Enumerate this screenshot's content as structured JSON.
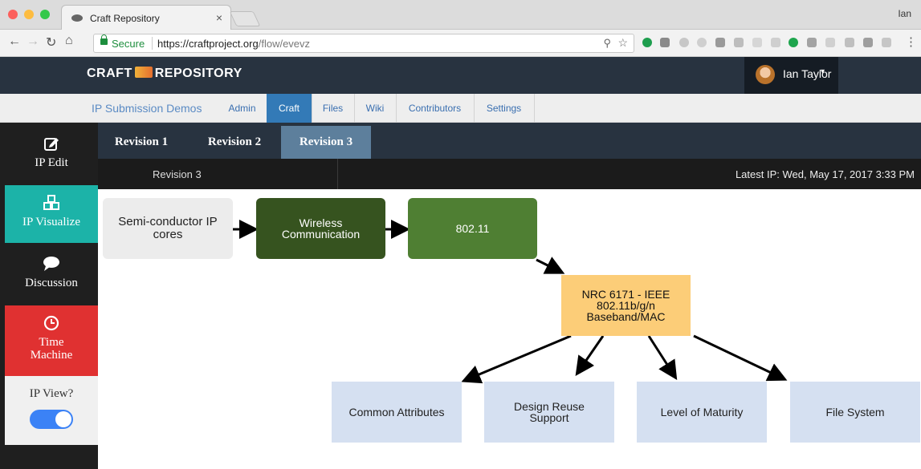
{
  "browser": {
    "tab_title": "Craft Repository",
    "tab_close": "×",
    "profile_name": "Ian",
    "secure_label": "Secure",
    "url_host": "https://craftproject.org",
    "url_path": "/flow/evevz"
  },
  "header": {
    "logo_left": "CRAFT",
    "logo_right": "REPOSITORY",
    "user_name": "Ian Taylor",
    "user_caret": "▾"
  },
  "subnav": {
    "brand": "IP Submission Demos",
    "links": [
      "Admin",
      "Craft",
      "Files",
      "Wiki",
      "Contributors",
      "Settings"
    ],
    "active": "Craft"
  },
  "sidebar": {
    "items": [
      {
        "label": "IP Edit",
        "icon": "edit-icon"
      },
      {
        "label": "IP Visualize",
        "icon": "cubes-icon"
      },
      {
        "label": "Discussion",
        "icon": "comment-icon"
      },
      {
        "label_line1": "Time",
        "label_line2": "Machine",
        "icon": "clock-icon"
      }
    ],
    "toggle_label": "IP View?",
    "toggle_on": true
  },
  "revisions": {
    "tabs": [
      "Revision 1",
      "Revision 2",
      "Revision 3"
    ],
    "active": "Revision 3",
    "current": "Revision 3",
    "latest": "Latest IP: Wed, May 17, 2017 3:33 PM"
  },
  "diagram": {
    "nodes": {
      "semi": {
        "line1": "Semi-conductor IP",
        "line2": "cores"
      },
      "wireless": {
        "line1": "Wireless",
        "line2": "Communication"
      },
      "wifi": {
        "line1": "802.11"
      },
      "nrc": {
        "line1": "NRC 6171 - IEEE",
        "line2": "802.11b/g/n",
        "line3": "Baseband/MAC"
      },
      "common": {
        "line1": "Common Attributes"
      },
      "design": {
        "line1": "Design Reuse",
        "line2": "Support"
      },
      "level": {
        "line1": "Level of Maturity"
      },
      "fs": {
        "line1": "File System"
      }
    }
  },
  "colors": {
    "header_bg": "#283340",
    "active_nav": "#337ab7",
    "sidebar_visualize": "#1cb3a8",
    "sidebar_time": "#e03131",
    "toggle": "#3b82f6"
  }
}
